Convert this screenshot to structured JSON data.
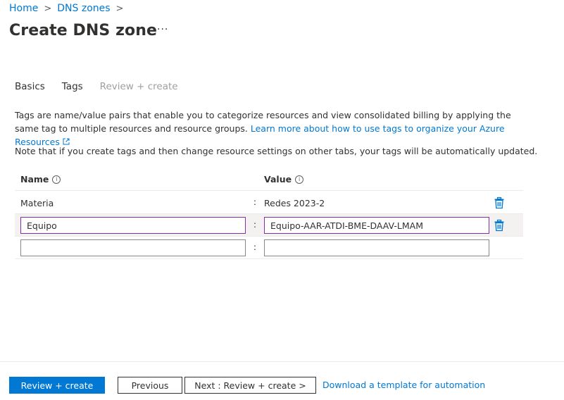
{
  "breadcrumb": {
    "items": [
      "Home",
      "DNS zones"
    ],
    "separator": ">"
  },
  "page": {
    "title": "Create DNS zone",
    "more_label": "···"
  },
  "tabs": [
    {
      "label": "Basics",
      "state": "normal"
    },
    {
      "label": "Tags",
      "state": "active"
    },
    {
      "label": "Review + create",
      "state": "disabled"
    }
  ],
  "description": {
    "text": "Tags are name/value pairs that enable you to categorize resources and view consolidated billing by applying the same tag to multiple resources and resource groups.",
    "link_text": "Learn more about how to use tags to organize your Azure Resources",
    "note": "Note that if you create tags and then change resource settings on other tabs, your tags will be automatically updated."
  },
  "tags_table": {
    "headers": {
      "name": "Name",
      "value": "Value"
    },
    "separator": ":",
    "rows": [
      {
        "name": "Materia",
        "value": "Redes 2023-2"
      },
      {
        "name": "Equipo",
        "value": "Equipo-AAR-ATDI-BME-DAAV-LMAM"
      },
      {
        "name": "",
        "value": ""
      }
    ]
  },
  "footer": {
    "review_create": "Review + create",
    "previous": "Previous",
    "next": "Next : Review + create >",
    "download_link": "Download a template for automation"
  },
  "colors": {
    "accent": "#0078d4",
    "focus_border": "#8a2ca8",
    "disabled_text": "#a19f9d"
  }
}
